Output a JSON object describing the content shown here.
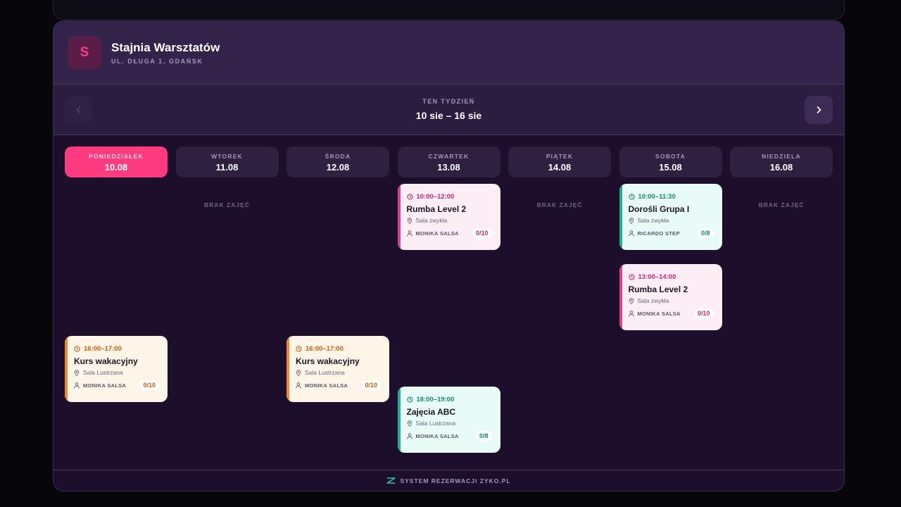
{
  "studio": {
    "initial": "S",
    "name": "Stajnia Warsztatów",
    "address": "UL. DŁUGA 1, GDAŃSK"
  },
  "week": {
    "label": "TEN TYDZIEŃ",
    "range": "10 sie – 16 sie",
    "prev_icon": "chevron-left-icon",
    "next_icon": "chevron-right-icon"
  },
  "days": [
    {
      "name": "PONIEDZIAŁEK",
      "date": "10.08",
      "active": true
    },
    {
      "name": "WTOREK",
      "date": "11.08",
      "active": false
    },
    {
      "name": "ŚRODA",
      "date": "12.08",
      "active": false
    },
    {
      "name": "CZWARTEK",
      "date": "13.08",
      "active": false
    },
    {
      "name": "PIĄTEK",
      "date": "14.08",
      "active": false
    },
    {
      "name": "SOBOTA",
      "date": "15.08",
      "active": false
    },
    {
      "name": "NIEDZIELA",
      "date": "16.08",
      "active": false
    }
  ],
  "empty_label": "BRAK ZAJĘĆ",
  "classes": [
    {
      "day": "CZWARTEK",
      "time": "10:00–12:00",
      "title": "Rumba Level 2",
      "room": "Sala zwykła",
      "coach": "MONIKA SALSA",
      "capacity": "0/10",
      "color": "pink"
    },
    {
      "day": "SOBOTA",
      "time": "10:00–11:30",
      "title": "Dorośli Grupa I",
      "room": "Sala zwykła",
      "coach": "RICARDO STEP",
      "capacity": "0/8",
      "color": "mint"
    },
    {
      "day": "SOBOTA",
      "time": "13:00–14:00",
      "title": "Rumba Level 2",
      "room": "Sala zwykła",
      "coach": "MONIKA SALSA",
      "capacity": "0/10",
      "color": "pink"
    },
    {
      "day": "PONIEDZIAŁEK",
      "time": "16:00–17:00",
      "title": "Kurs wakacyjny",
      "room": "Sala Lustrzana",
      "coach": "MONIKA SALSA",
      "capacity": "0/10",
      "color": "cream"
    },
    {
      "day": "ŚRODA",
      "time": "16:00–17:00",
      "title": "Kurs wakacyjny",
      "room": "Sala Lustrzana",
      "coach": "MONIKA SALSA",
      "capacity": "0/10",
      "color": "cream"
    },
    {
      "day": "CZWARTEK",
      "time": "18:00–19:00",
      "title": "Zajęcia ABC",
      "room": "Sala Lustrzana",
      "coach": "MONIKA SALSA",
      "capacity": "0/8",
      "color": "mint"
    }
  ],
  "footer": {
    "text": "SYSTEM REZERWACJI ZYKO.PL",
    "icon": "zyko-logo-icon"
  },
  "colors": {
    "accent_pink": "#ff3b80",
    "panel_bg": "#1d0f2c",
    "header_bg": "#33234a"
  }
}
